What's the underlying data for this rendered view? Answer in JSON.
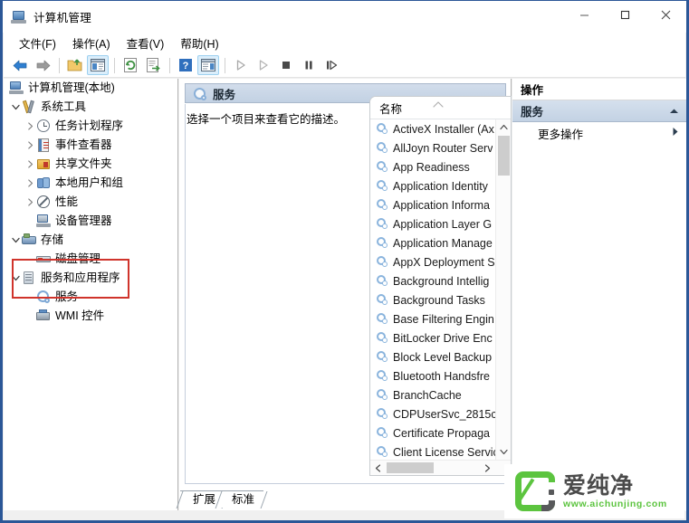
{
  "window": {
    "title": "计算机管理",
    "icon": "computer-management-icon",
    "minimize_label": "最小化",
    "maximize_label": "最大化",
    "close_label": "关闭"
  },
  "menubar": {
    "items": [
      {
        "label": "文件(F)",
        "name": "menu-file"
      },
      {
        "label": "操作(A)",
        "name": "menu-action"
      },
      {
        "label": "查看(V)",
        "name": "menu-view"
      },
      {
        "label": "帮助(H)",
        "name": "menu-help"
      }
    ]
  },
  "toolbar": {
    "buttons": [
      {
        "name": "back-button",
        "icon": "arrow-left-icon",
        "active": false
      },
      {
        "name": "forward-button",
        "icon": "arrow-right-icon",
        "active": false
      },
      {
        "name": "up-one-level-button",
        "icon": "folder-up-icon",
        "active": false
      },
      {
        "name": "show-hide-console-tree-button",
        "icon": "console-tree-icon",
        "active": true
      },
      {
        "name": "refresh-button",
        "icon": "refresh-icon",
        "active": false
      },
      {
        "name": "export-list-button",
        "icon": "export-icon",
        "active": false
      },
      {
        "name": "help-button",
        "icon": "question-mark-icon",
        "active": false
      },
      {
        "name": "show-hide-action-pane-button",
        "icon": "action-pane-icon",
        "active": true
      },
      {
        "name": "start-service-button",
        "icon": "play-icon",
        "active": false
      },
      {
        "name": "resume-service-button",
        "icon": "play-outline-icon",
        "active": false
      },
      {
        "name": "stop-service-button",
        "icon": "stop-icon",
        "active": false
      },
      {
        "name": "pause-service-button",
        "icon": "pause-icon",
        "active": false
      },
      {
        "name": "restart-service-button",
        "icon": "restart-icon",
        "active": false
      }
    ]
  },
  "tree": {
    "root": {
      "label": "计算机管理(本地)",
      "icon": "computer-icon",
      "indent": 0,
      "expander": "none"
    },
    "nodes": [
      {
        "label": "系统工具",
        "icon": "system-tools-icon",
        "indent": 1,
        "expander": "expanded"
      },
      {
        "label": "任务计划程序",
        "icon": "task-scheduler-icon",
        "indent": 2,
        "expander": "collapsed"
      },
      {
        "label": "事件查看器",
        "icon": "event-viewer-icon",
        "indent": 2,
        "expander": "collapsed"
      },
      {
        "label": "共享文件夹",
        "icon": "shared-folders-icon",
        "indent": 2,
        "expander": "collapsed"
      },
      {
        "label": "本地用户和组",
        "icon": "local-users-icon",
        "indent": 2,
        "expander": "collapsed"
      },
      {
        "label": "性能",
        "icon": "performance-icon",
        "indent": 2,
        "expander": "collapsed"
      },
      {
        "label": "设备管理器",
        "icon": "device-manager-icon",
        "indent": 2,
        "expander": "none"
      },
      {
        "label": "存储",
        "icon": "storage-icon",
        "indent": 1,
        "expander": "expanded"
      },
      {
        "label": "磁盘管理",
        "icon": "disk-management-icon",
        "indent": 2,
        "expander": "none"
      },
      {
        "label": "服务和应用程序",
        "icon": "services-apps-icon",
        "indent": 1,
        "expander": "expanded"
      },
      {
        "label": "服务",
        "icon": "services-gear-icon",
        "indent": 2,
        "expander": "none",
        "highlighted": true
      },
      {
        "label": "WMI 控件",
        "icon": "wmi-control-icon",
        "indent": 2,
        "expander": "none"
      }
    ]
  },
  "details": {
    "header_title": "服务",
    "header_icon": "services-gear-icon",
    "description": "选择一个项目来查看它的描述。",
    "column_header": "名称",
    "sort_direction": "ascending",
    "services": [
      "ActiveX Installer (Ax",
      "AllJoyn Router Serv",
      "App Readiness",
      "Application Identity",
      "Application Informa",
      "Application Layer G",
      "Application Manage",
      "AppX Deployment S",
      "Background Intellig",
      "Background Tasks",
      "Base Filtering Engin",
      "BitLocker Drive Enc",
      "Block Level Backup",
      "Bluetooth Handsfre",
      "BranchCache",
      "CDPUserSvc_2815c",
      "Certificate Propaga",
      "Client License Servic"
    ],
    "tabs": [
      {
        "label": "扩展",
        "selected": false
      },
      {
        "label": "标准",
        "selected": true
      }
    ]
  },
  "actions": {
    "title": "操作",
    "group": {
      "label": "服务",
      "collapse_icon": "chevron-up-icon"
    },
    "items": [
      {
        "label": "更多操作",
        "submenu_icon": "chevron-right-icon"
      }
    ]
  },
  "watermark": {
    "brand_cn": "爱纯净",
    "url": "www.aichunjing.com",
    "logo_name": "aichunjing-logo"
  },
  "colors": {
    "window_border": "#2b5797",
    "highlight_red": "#d0342c",
    "header_gradient_top": "#d2ddeb",
    "header_gradient_bottom": "#c2d1e3",
    "brand_green": "#5cc43f",
    "brand_gray": "#58595b"
  }
}
